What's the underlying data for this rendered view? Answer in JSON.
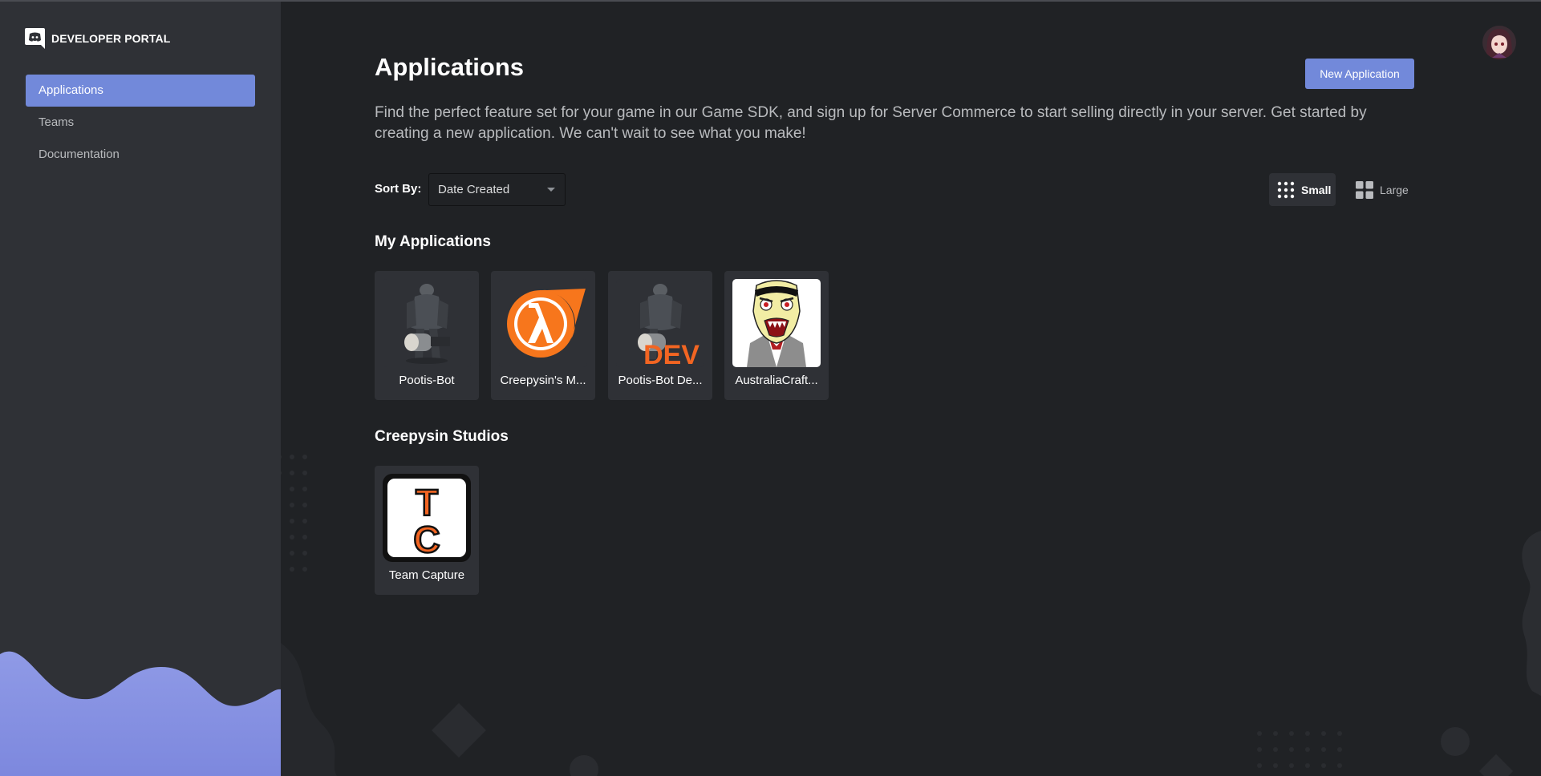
{
  "brand": {
    "name": "DEVELOPER PORTAL",
    "logo_icon": "discord-logo-icon"
  },
  "sidebar": {
    "items": [
      {
        "label": "Applications",
        "active": true
      },
      {
        "label": "Teams",
        "active": false
      },
      {
        "label": "Documentation",
        "active": false
      }
    ]
  },
  "header": {
    "title": "Applications",
    "new_button_label": "New Application",
    "intro": "Find the perfect feature set for your game in our Game SDK, and sign up for Server Commerce to start selling directly in your server. Get started by creating a new application. We can't wait to see what you make!"
  },
  "controls": {
    "sort_label": "Sort By:",
    "sort_value": "Date Created",
    "view_small_label": "Small",
    "view_large_label": "Large",
    "selected_view": "Small"
  },
  "sections": {
    "my_apps": {
      "title": "My Applications",
      "apps": [
        {
          "name": "Pootis-Bot",
          "icon": "heavy-soldier-avatar"
        },
        {
          "name": "Creepysin's M...",
          "icon": "half-life-lambda-icon"
        },
        {
          "name": "Pootis-Bot De...",
          "icon": "heavy-soldier-dev-avatar",
          "overlay_text": "DEV"
        },
        {
          "name": "AustraliaCraft...",
          "icon": "cartoon-vampire-avatar"
        }
      ]
    },
    "team": {
      "title": "Creepysin Studios",
      "apps": [
        {
          "name": "Team Capture",
          "icon": "tc-logo-icon",
          "logo_letters": [
            "T",
            "C"
          ]
        }
      ]
    }
  },
  "colors": {
    "accent": "#7289da",
    "sidebar_bg": "#2f3136",
    "main_bg": "#202225",
    "lambda_orange": "#f7761c"
  }
}
